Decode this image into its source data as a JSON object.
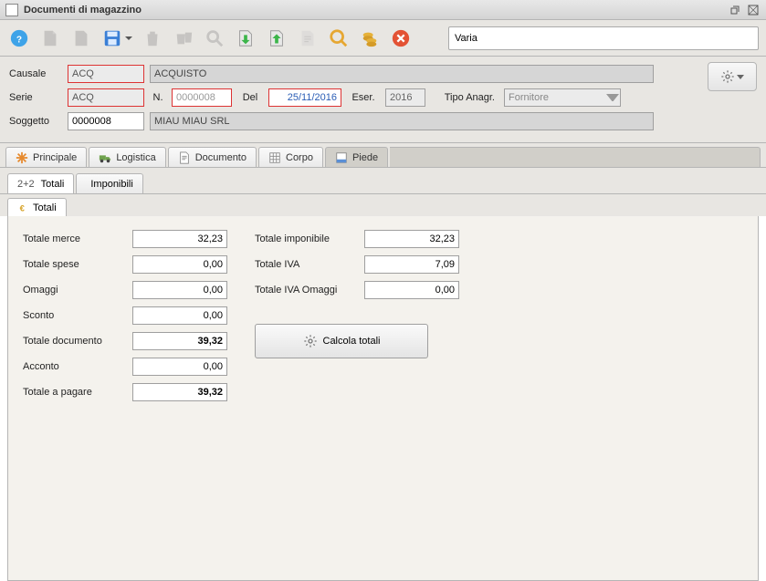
{
  "window": {
    "title": "Documenti di magazzino"
  },
  "toolbar": {
    "search_value": "Varia"
  },
  "header": {
    "causale_label": "Causale",
    "causale_value": "ACQ",
    "causale_desc": "ACQUISTO",
    "serie_label": "Serie",
    "serie_value": "ACQ",
    "n_label": "N.",
    "n_value": "0000008",
    "del_label": "Del",
    "del_value": "25/11/2016",
    "eser_label": "Eser.",
    "eser_value": "2016",
    "tipo_anagr_label": "Tipo Anagr.",
    "tipo_anagr_value": "Fornitore",
    "soggetto_label": "Soggetto",
    "soggetto_code": "0000008",
    "soggetto_name": "MIAU MIAU SRL"
  },
  "tabs1": {
    "principale": "Principale",
    "logistica": "Logistica",
    "documento": "Documento",
    "corpo": "Corpo",
    "piede": "Piede"
  },
  "tabs2": {
    "totali_prefix": "2+2",
    "totali": "Totali",
    "imponibili": "Imponibili"
  },
  "tabs3": {
    "totali": "Totali"
  },
  "totals": {
    "totale_merce_label": "Totale merce",
    "totale_merce_value": "32,23",
    "totale_spese_label": "Totale spese",
    "totale_spese_value": "0,00",
    "omaggi_label": "Omaggi",
    "omaggi_value": "0,00",
    "sconto_label": "Sconto",
    "sconto_value": "0,00",
    "totale_documento_label": "Totale documento",
    "totale_documento_value": "39,32",
    "acconto_label": "Acconto",
    "acconto_value": "0,00",
    "totale_pagare_label": "Totale a pagare",
    "totale_pagare_value": "39,32",
    "totale_imponibile_label": "Totale imponibile",
    "totale_imponibile_value": "32,23",
    "totale_iva_label": "Totale IVA",
    "totale_iva_value": "7,09",
    "totale_iva_omaggi_label": "Totale IVA Omaggi",
    "totale_iva_omaggi_value": "0,00",
    "calcola_button": "Calcola totali"
  }
}
